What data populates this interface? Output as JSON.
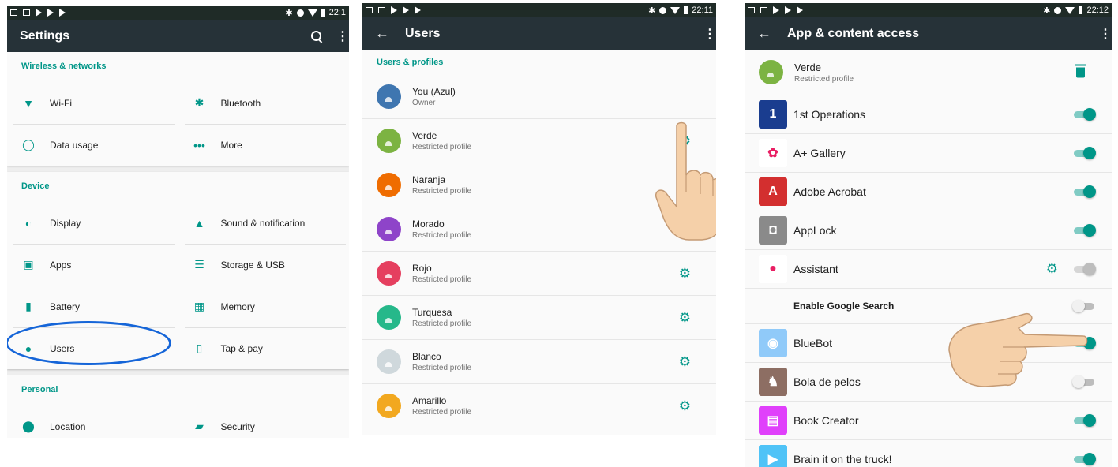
{
  "colors": {
    "accent": "#009688",
    "appbar": "#263238",
    "highlight": "#1565d8"
  },
  "status": {
    "time1": "22:1",
    "time2": "22:11",
    "time3": "22:12"
  },
  "settings": {
    "title": "Settings",
    "sections": [
      {
        "header": "Wireless & networks",
        "rows": [
          [
            {
              "label": "Wi-Fi",
              "icon": "wifi-icon",
              "glyph": "▼"
            },
            {
              "label": "Bluetooth",
              "icon": "bluetooth-icon",
              "glyph": "✱"
            }
          ],
          [
            {
              "label": "Data usage",
              "icon": "data-usage-icon",
              "glyph": "◯"
            },
            {
              "label": "More",
              "icon": "more-icon",
              "glyph": "•••"
            }
          ]
        ]
      },
      {
        "header": "Device",
        "rows": [
          [
            {
              "label": "Display",
              "icon": "brightness-icon",
              "glyph": "◐"
            },
            {
              "label": "Sound & notification",
              "icon": "bell-icon",
              "glyph": "▲"
            }
          ],
          [
            {
              "label": "Apps",
              "icon": "android-icon",
              "glyph": "▣"
            },
            {
              "label": "Storage & USB",
              "icon": "storage-icon",
              "glyph": "☰"
            }
          ],
          [
            {
              "label": "Battery",
              "icon": "battery-icon",
              "glyph": "▮"
            },
            {
              "label": "Memory",
              "icon": "memory-icon",
              "glyph": "▦"
            }
          ],
          [
            {
              "label": "Users",
              "icon": "person-icon",
              "glyph": "●"
            },
            {
              "label": "Tap & pay",
              "icon": "tap-pay-icon",
              "glyph": "▯"
            }
          ]
        ]
      },
      {
        "header": "Personal",
        "rows": [
          [
            {
              "label": "Location",
              "icon": "location-icon",
              "glyph": "⬤"
            },
            {
              "label": "Security",
              "icon": "lock-icon",
              "glyph": "▰"
            }
          ]
        ]
      }
    ]
  },
  "users": {
    "title": "Users",
    "section": "Users & profiles",
    "list": [
      {
        "name": "You (Azul)",
        "sub": "Owner",
        "color": "#3f76b0",
        "gear": false
      },
      {
        "name": "Verde",
        "sub": "Restricted profile",
        "color": "#7cb342",
        "gear": true
      },
      {
        "name": "Naranja",
        "sub": "Restricted profile",
        "color": "#ef6c00",
        "gear": true
      },
      {
        "name": "Morado",
        "sub": "Restricted profile",
        "color": "#8e44c9",
        "gear": true
      },
      {
        "name": "Rojo",
        "sub": "Restricted profile",
        "color": "#e53f5f",
        "gear": true
      },
      {
        "name": "Turquesa",
        "sub": "Restricted profile",
        "color": "#26b88a",
        "gear": true
      },
      {
        "name": "Blanco",
        "sub": "Restricted profile",
        "color": "#cfd8dc",
        "gear": true
      },
      {
        "name": "Amarillo",
        "sub": "Restricted profile",
        "color": "#f2a81f",
        "gear": true
      },
      {
        "name": "",
        "sub": "",
        "color": "#9e9e9e",
        "gear": false
      }
    ]
  },
  "access": {
    "title": "App & content access",
    "profile": {
      "name": "Verde",
      "sub": "Restricted profile",
      "color": "#7cb342"
    },
    "apps": [
      {
        "label": "1st Operations",
        "state": "on",
        "icon_color": "#1a3d8f",
        "icon": "operations-icon",
        "glyph": "1",
        "gear": false
      },
      {
        "label": "A+ Gallery",
        "state": "on",
        "icon_color": "#ffffff",
        "icon": "gallery-flower-icon",
        "glyph": "✿",
        "gear": false
      },
      {
        "label": "Adobe Acrobat",
        "state": "on",
        "icon_color": "#d32f2f",
        "icon": "acrobat-icon",
        "glyph": "A",
        "gear": false
      },
      {
        "label": "AppLock",
        "state": "on",
        "icon_color": "#8a8a8a",
        "icon": "applock-icon",
        "glyph": "◘",
        "gear": false
      },
      {
        "label": "Assistant",
        "state": "disabled",
        "icon_color": "#ffffff",
        "icon": "assistant-icon",
        "glyph": "●",
        "gear": true
      },
      {
        "label": "Enable Google Search",
        "state": "off",
        "icon_color": "",
        "icon": "",
        "glyph": "",
        "gear": false,
        "sub": true
      },
      {
        "label": "BlueBot",
        "state": "on",
        "icon_color": "#90caf9",
        "icon": "bluebot-icon",
        "glyph": "◉",
        "gear": false
      },
      {
        "label": "Bola de pelos",
        "state": "off",
        "icon_color": "#8d6e63",
        "icon": "bola-de-pelos-icon",
        "glyph": "♞",
        "gear": false
      },
      {
        "label": "Book Creator",
        "state": "on",
        "icon_color": "#e040fb",
        "icon": "book-creator-icon",
        "glyph": "▤",
        "gear": false
      },
      {
        "label": "Brain it on the truck!",
        "state": "on",
        "icon_color": "#4fc3f7",
        "icon": "truck-icon",
        "glyph": "▶",
        "gear": false
      }
    ]
  }
}
